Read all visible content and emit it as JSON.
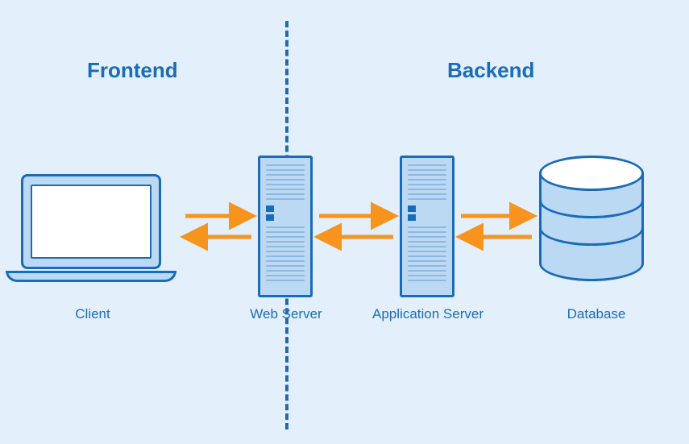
{
  "sections": {
    "frontend": "Frontend",
    "backend": "Backend"
  },
  "nodes": {
    "client": "Client",
    "web_server": "Web Server",
    "app_server": "Application Server",
    "database": "Database"
  },
  "colors": {
    "bg": "#e3f0fb",
    "stroke": "#1a6bb8",
    "fill_light": "#bcd9f3",
    "arrow": "#f7941e"
  },
  "arrows": [
    {
      "from": "client",
      "to": "web_server",
      "bidirectional": true
    },
    {
      "from": "web_server",
      "to": "app_server",
      "bidirectional": true
    },
    {
      "from": "app_server",
      "to": "database",
      "bidirectional": true
    }
  ]
}
